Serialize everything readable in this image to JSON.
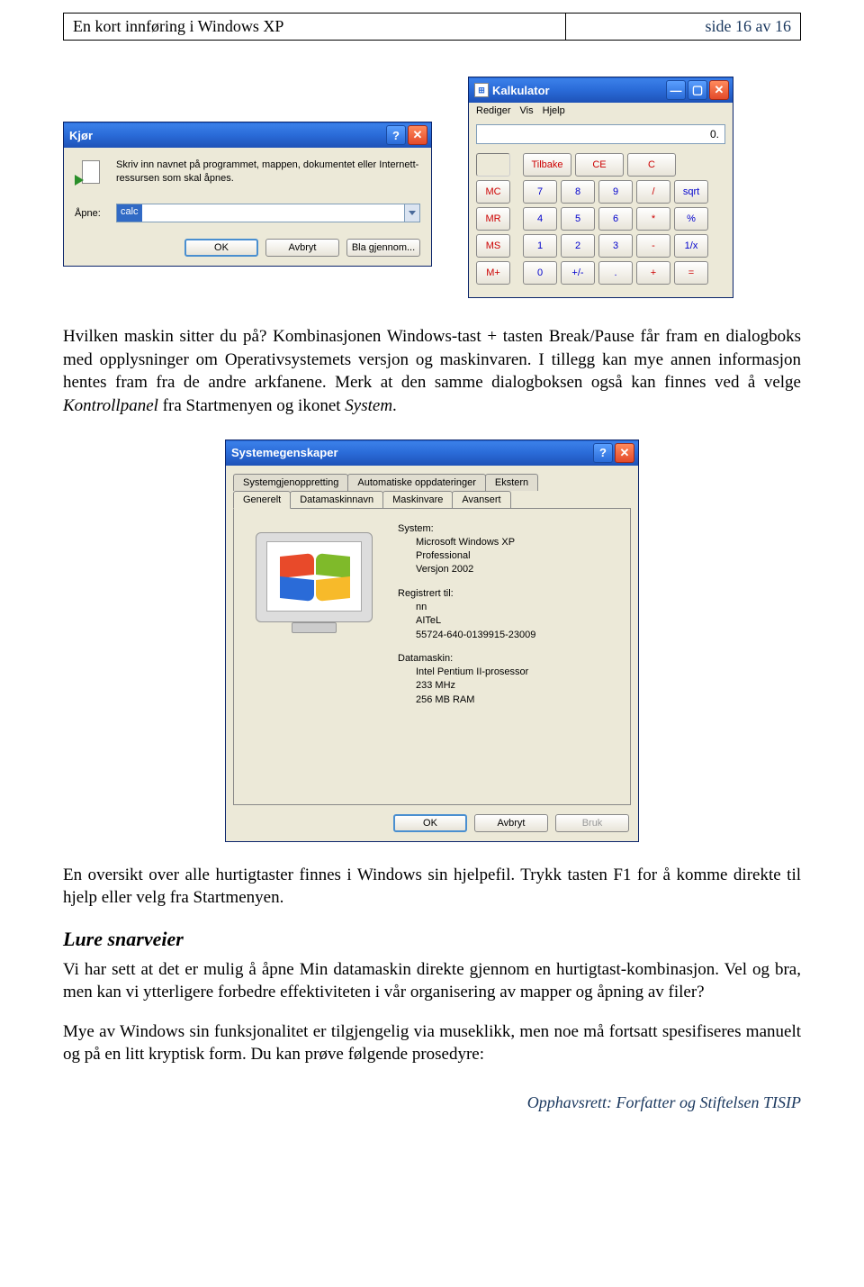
{
  "header": {
    "left": "En kort innføring i Windows XP",
    "right": "side 16 av 16"
  },
  "run_dialog": {
    "title": "Kjør",
    "instruction": "Skriv inn navnet på programmet, mappen, dokumentet eller Internett-ressursen som skal åpnes.",
    "open_label": "Åpne:",
    "value": "calc",
    "ok": "OK",
    "cancel": "Avbryt",
    "browse": "Bla gjennom..."
  },
  "calc": {
    "title": "Kalkulator",
    "menu": [
      "Rediger",
      "Vis",
      "Hjelp"
    ],
    "display": "0.",
    "row_top": [
      "",
      "Tilbake",
      "CE",
      "C"
    ],
    "rows": [
      [
        "MC",
        "7",
        "8",
        "9",
        "/",
        "sqrt"
      ],
      [
        "MR",
        "4",
        "5",
        "6",
        "*",
        "%"
      ],
      [
        "MS",
        "1",
        "2",
        "3",
        "-",
        "1/x"
      ],
      [
        "M+",
        "0",
        "+/-",
        ".",
        "+",
        "="
      ]
    ]
  },
  "para1": "Hvilken maskin sitter du på? Kombinasjonen Windows-tast + tasten Break/Pause får fram en dialogboks med opplysninger om Operativsystemets versjon og maskinvaren. I tillegg kan mye annen informasjon hentes fram fra de andre arkfanene. Merk at den samme dialogboksen også kan finnes ved å velge ",
  "para1_em1": "Kontrollpanel",
  "para1_mid": " fra Startmenyen og ikonet ",
  "para1_em2": "System",
  "para1_end": ".",
  "sysprops": {
    "title": "Systemegenskaper",
    "tabs_back": [
      "Systemgjenoppretting",
      "Automatiske oppdateringer",
      "Ekstern"
    ],
    "tabs_front": [
      "Generelt",
      "Datamaskinnavn",
      "Maskinvare",
      "Avansert"
    ],
    "active_tab": "Generelt",
    "system_hdr": "System:",
    "system_lines": [
      "Microsoft Windows XP",
      "Professional",
      "Versjon 2002"
    ],
    "reg_hdr": "Registrert til:",
    "reg_lines": [
      "nn",
      "AITeL",
      "55724-640-0139915-23009"
    ],
    "comp_hdr": "Datamaskin:",
    "comp_lines": [
      "Intel Pentium II-prosessor",
      "233 MHz",
      "256 MB RAM"
    ],
    "ok": "OK",
    "cancel": "Avbryt",
    "apply": "Bruk"
  },
  "para2": "En oversikt over alle hurtigtaster finnes i Windows sin hjelpefil. Trykk tasten F1 for å komme direkte til hjelp eller velg fra Startmenyen.",
  "section_heading": "Lure snarveier",
  "para3": "Vi har sett at det er mulig å åpne Min datamaskin direkte gjennom en hurtigtast-kombinasjon. Vel og bra, men kan vi ytterligere forbedre effektiviteten i vår organisering av mapper og åpning av filer?",
  "para4": "Mye av Windows sin funksjonalitet er tilgjengelig via museklikk, men noe må fortsatt spesifiseres manuelt og på en litt kryptisk form. Du kan prøve følgende prosedyre:",
  "footer": "Opphavsrett:  Forfatter og Stiftelsen TISIP"
}
